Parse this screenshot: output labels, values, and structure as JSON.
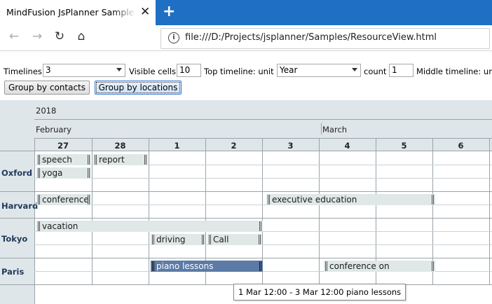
{
  "browser": {
    "tab_title": "MindFusion JsPlanner Sample - Resource View",
    "url": "file:///D:/Projects/jsplanner/Samples/ResourceView.html"
  },
  "controls": {
    "timelines_label": "Timelines",
    "timelines_value": "3",
    "visible_cells_label": "Visible cells",
    "visible_cells_value": "10",
    "top_timeline_unit_label": "Top timeline: unit",
    "top_timeline_unit_value": "Year",
    "count_label": "count",
    "count_value": "1",
    "middle_timeline_label": "Middle timeline: un",
    "group_contacts_label": "Group by contacts",
    "group_locations_label": "Group by locations"
  },
  "timeline": {
    "year": "2018",
    "months": [
      "February",
      "March"
    ],
    "days": [
      "27",
      "28",
      "1",
      "2",
      "3",
      "4",
      "5",
      "6"
    ]
  },
  "resources": [
    "Oxford",
    "Harvard",
    "Tokyo",
    "Paris"
  ],
  "events": {
    "speech": "speech",
    "report": "report",
    "yoga": "yoga",
    "conference": "conference",
    "executive_education": "executive education",
    "vacation": "vacation",
    "driving": "driving",
    "call": "Call",
    "piano_lessons": "piano lessons",
    "conference_on": "conference on"
  },
  "tooltip": "1 Mar 12:00 - 3 Mar 12:00 piano lessons",
  "colors": {
    "tabbar": "#1f6fc4",
    "header": "#dfe6e9",
    "event": "#dfe7e7",
    "selected_event": "#5b7aa6"
  }
}
